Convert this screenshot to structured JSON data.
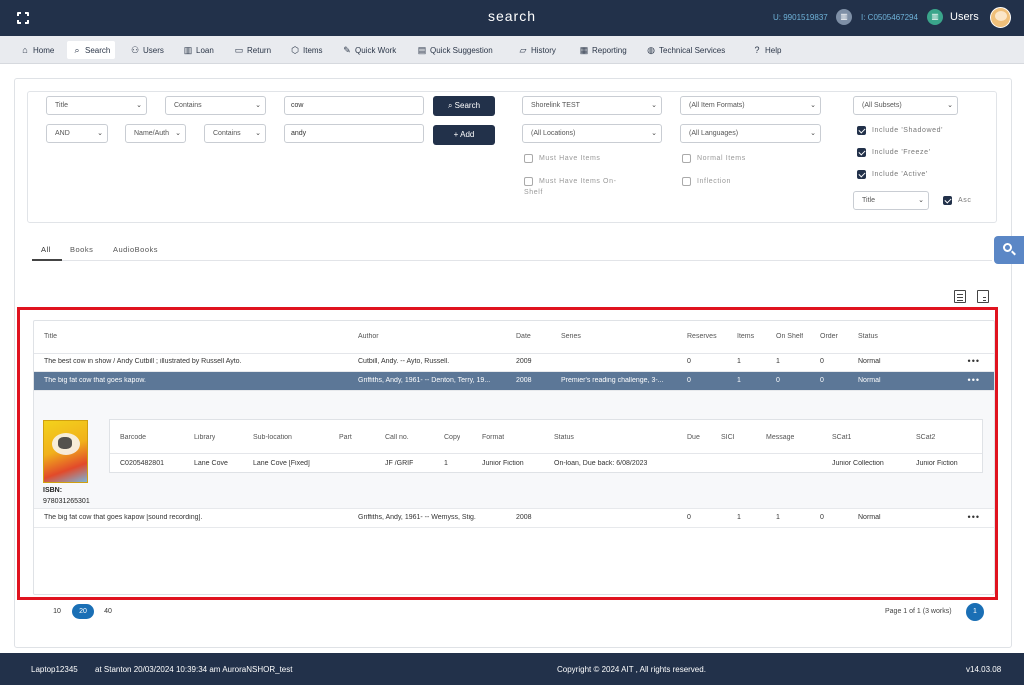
{
  "topbar": {
    "title": "search",
    "user_id": "U: 9901519837",
    "institution_id": "I: C0505467294",
    "users_label": "Users"
  },
  "nav": [
    {
      "label": "Home",
      "icon": "home-icon",
      "glyph": "⌂"
    },
    {
      "label": "Search",
      "icon": "search-icon",
      "glyph": "⌕",
      "active": true
    },
    {
      "label": "Users",
      "icon": "users-icon",
      "glyph": "⚇"
    },
    {
      "label": "Loan",
      "icon": "book-icon",
      "glyph": "▥"
    },
    {
      "label": "Return",
      "icon": "return-icon",
      "glyph": "▭"
    },
    {
      "label": "Items",
      "icon": "box-icon",
      "glyph": "⬡"
    },
    {
      "label": "Quick Work",
      "icon": "edit-icon",
      "glyph": "✎"
    },
    {
      "label": "Quick Suggestion",
      "icon": "document-icon",
      "glyph": "▤"
    },
    {
      "label": "History",
      "icon": "folder-icon",
      "glyph": "▱"
    },
    {
      "label": "Reporting",
      "icon": "report-icon",
      "glyph": "▦"
    },
    {
      "label": "Technical Services",
      "icon": "globe-icon",
      "glyph": "◍"
    },
    {
      "label": "Help",
      "icon": "help-icon",
      "glyph": "?"
    }
  ],
  "search": {
    "row1": {
      "field": "Title",
      "op": "Contains",
      "value": "cow"
    },
    "row2": {
      "bool": "AND",
      "field": "Name/Auth",
      "op": "Contains",
      "value": "andy"
    },
    "search_button": "Search",
    "add_button": "+ Add",
    "library": "Shorelink TEST",
    "location": "(All Locations)",
    "item_formats": "(All Item Formats)",
    "languages": "(All Languages)",
    "subsets": "(All Subsets)",
    "sort": "Title",
    "checks": {
      "must_have_items": "Must Have Items",
      "must_have_items_on_shelf": "Must Have Items On-Shelf",
      "normal_items": "Normal Items",
      "inflection": "Inflection",
      "include_shadowed": "Include 'Shadowed'",
      "include_freeze": "Include 'Freeze'",
      "include_active": "Include 'Active'",
      "asc": "Asc"
    }
  },
  "tabs": [
    "All",
    "Books",
    "AudioBooks"
  ],
  "results": {
    "columns": [
      "Title",
      "Author",
      "Date",
      "Series",
      "Reserves",
      "Items",
      "On Shelf",
      "Order",
      "Status"
    ],
    "rows": [
      {
        "title": "The best cow in show / Andy Cutbill ; illustrated by Russell Ayto.",
        "author": "Cutbill, Andy. -- Ayto, Russell.",
        "date": "2009",
        "series": "",
        "reserves": "0",
        "items": "1",
        "on_shelf": "1",
        "order": "0",
        "status": "Normal"
      },
      {
        "title": "The big fat cow that goes kapow.",
        "author": "Griffiths, Andy, 1961- -- Denton, Terry, 19...",
        "date": "2008",
        "series": "Premier's reading challenge, 3-...",
        "reserves": "0",
        "items": "1",
        "on_shelf": "0",
        "order": "0",
        "status": "Normal"
      },
      {
        "title": "The big fat cow that goes kapow [sound recording].",
        "author": "Griffiths, Andy, 1961- -- Wemyss, Stig.",
        "date": "2008",
        "series": "",
        "reserves": "0",
        "items": "1",
        "on_shelf": "1",
        "order": "0",
        "status": "Normal"
      }
    ],
    "detail": {
      "isbn_label": "ISBN:",
      "isbn": "978031265301",
      "columns": [
        "Barcode",
        "Library",
        "Sub-location",
        "Part",
        "Call no.",
        "Copy",
        "Format",
        "Status",
        "Due",
        "SICI",
        "Message",
        "SCat1",
        "SCat2"
      ],
      "row": {
        "barcode": "C0205482801",
        "library": "Lane Cove",
        "sublocation": "Lane Cove [Fixed]",
        "part": "",
        "callno": "JF /GRIF",
        "copy": "1",
        "format": "Junior Fiction",
        "status": "On-loan, Due back: 6/08/2023",
        "due": "",
        "sici": "",
        "message": "",
        "scat1": "Junior Collection",
        "scat2": "Junior Fiction"
      }
    }
  },
  "pagination": {
    "sizes": [
      "10",
      "20",
      "40"
    ],
    "selected_size": "20",
    "summary": "Page 1 of 1 (3 works)",
    "current_page": "1"
  },
  "footer": {
    "device": "Laptop12345",
    "session": "at Stanton 20/03/2024 10:39:34 am AuroraNSHOR_test",
    "copyright": "Copyright © 2024 AIT , All rights reserved.",
    "version": "v14.03.08"
  },
  "colors": {
    "navy": "#22314a",
    "selected_row": "#5c7797",
    "highlight_border": "#e0131f",
    "accent": "#1a6fb5"
  }
}
